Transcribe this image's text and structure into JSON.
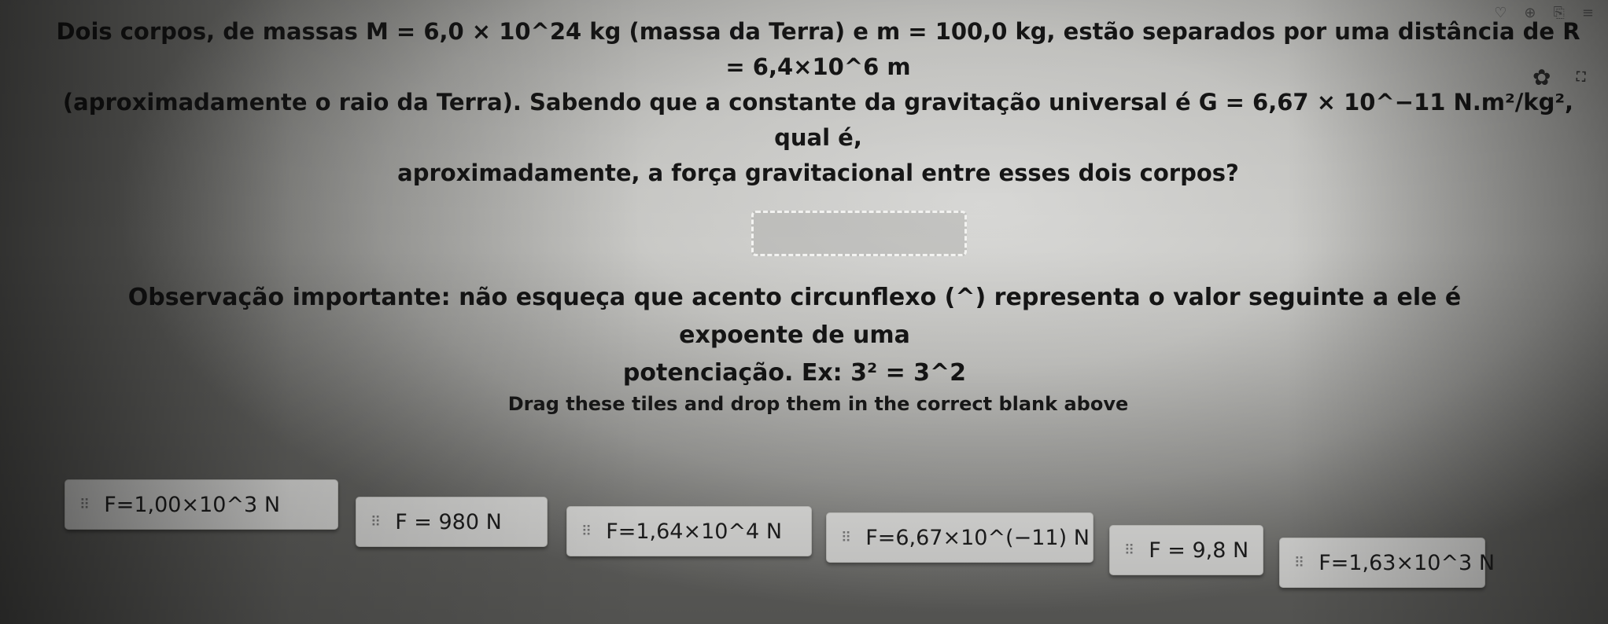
{
  "question": {
    "line1": "Dois corpos, de massas M = 6,0 × 10^24 kg (massa da Terra) e m = 100,0 kg, estão separados por uma distância de R = 6,4×10^6 m",
    "line2": "(aproximadamente o raio da Terra). Sabendo que a constante da gravitação universal é G = 6,67 × 10^−11 N.m²/kg², qual é,",
    "line3": "aproximadamente, a força gravitacional entre esses dois corpos?"
  },
  "observation": {
    "line1": "Observação importante: não esqueça que acento circunflexo (^) representa o valor seguinte a ele é expoente de uma",
    "line2": "potenciação. Ex: 3² = 3^2"
  },
  "instruction": "Drag these tiles and drop them in the correct blank above",
  "tiles": [
    {
      "grip": "⠿",
      "label": "F=1,00×10^3 N"
    },
    {
      "grip": "⠿",
      "label": "F = 980 N"
    },
    {
      "grip": "⠿",
      "label": "F=1,64×10^4 N"
    },
    {
      "grip": "⠿",
      "label": "F=6,67×10^(−11) N"
    },
    {
      "grip": "⠿",
      "label": "F = 9,8 N"
    },
    {
      "grip": "⠿",
      "label": "F=1,63×10^3 N"
    }
  ],
  "icons": {
    "settings": "gear-icon",
    "fullscreen": "expand-icon",
    "toolbar": [
      "shield-icon",
      "download-icon",
      "extensions-icon",
      "menu-icon"
    ]
  },
  "glyphs": {
    "gear": "✿",
    "expand": "⛶",
    "toolbar": [
      "♡",
      "⊕",
      "⎘",
      "≡"
    ]
  }
}
